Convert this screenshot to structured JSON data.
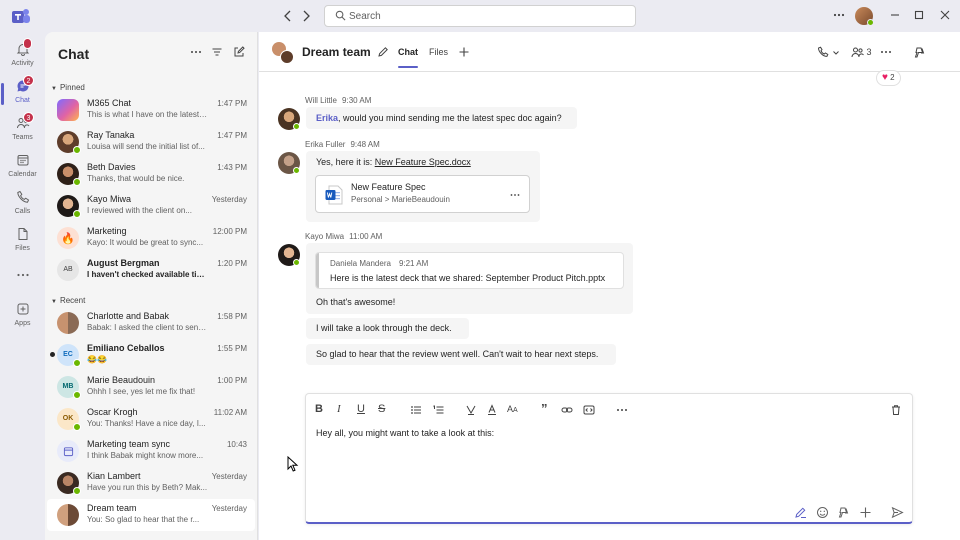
{
  "app": {
    "brand_color": "#5b5fc7",
    "window_title": ""
  },
  "titlebar": {
    "search_placeholder": "Search",
    "icons": [
      "teams-logo-icon",
      "back-icon",
      "forward-icon",
      "search-icon",
      "more-icon",
      "minimize-icon",
      "maximize-icon",
      "close-icon"
    ]
  },
  "rail": {
    "items": [
      {
        "label": "Activity",
        "badge": ""
      },
      {
        "label": "Chat",
        "badge": "2"
      },
      {
        "label": "Teams",
        "badge": "3"
      },
      {
        "label": "Calendar",
        "badge": ""
      },
      {
        "label": "Calls",
        "badge": ""
      },
      {
        "label": "Files",
        "badge": ""
      },
      {
        "label": "",
        "badge": ""
      },
      {
        "label": "Apps",
        "badge": ""
      }
    ]
  },
  "chatlist": {
    "title": "Chat",
    "pinned_label": "Pinned",
    "recent_label": "Recent",
    "pinned": [
      {
        "name": "M365 Chat",
        "time": "1:47 PM",
        "preview": "This is what I have on the latest o..."
      },
      {
        "name": "Ray Tanaka",
        "time": "1:47 PM",
        "preview": "Louisa will send the initial list of..."
      },
      {
        "name": "Beth Davies",
        "time": "1:43 PM",
        "preview": "Thanks, that would be nice."
      },
      {
        "name": "Kayo Miwa",
        "time": "Yesterday",
        "preview": "I reviewed with the client on..."
      },
      {
        "name": "Marketing",
        "time": "12:00 PM",
        "preview": "Kayo: It would be great to sync..."
      },
      {
        "name": "August Bergman",
        "time": "1:20 PM",
        "preview": "I haven't checked available time...",
        "initials": "AB"
      }
    ],
    "recent": [
      {
        "name": "Charlotte and Babak",
        "time": "1:58 PM",
        "preview": "Babak: I asked the client to send..."
      },
      {
        "name": "Emiliano Ceballos",
        "time": "1:55 PM",
        "preview": "😂😂",
        "initials": "EC"
      },
      {
        "name": "Marie Beaudouin",
        "time": "1:00 PM",
        "preview": "Ohhh I see, yes let me fix that!",
        "initials": "MB"
      },
      {
        "name": "Oscar Krogh",
        "time": "11:02 AM",
        "preview": "You: Thanks! Have a nice day, I...",
        "initials": "OK"
      },
      {
        "name": "Marketing team sync",
        "time": "10:43",
        "preview": "I think Babak might know more..."
      },
      {
        "name": "Kian Lambert",
        "time": "Yesterday",
        "preview": "Have you run this by Beth? Mak..."
      },
      {
        "name": "Dream team",
        "time": "Yesterday",
        "preview": "You: So glad to hear that the r..."
      }
    ]
  },
  "conversation": {
    "title": "Dream team",
    "tabs": [
      "Chat",
      "Files"
    ],
    "participants_count": "3",
    "reaction_count": "2",
    "messages": [
      {
        "author": "Will Little",
        "time": "9:30 AM",
        "mention": "Erika",
        "text": ", would you mind sending me the latest spec doc again?"
      },
      {
        "author": "Erika Fuller",
        "time": "9:48 AM",
        "text": "Yes, here it is: ",
        "link": "New Feature Spec.docx",
        "file": {
          "name": "New Feature Spec",
          "path": "Personal > MarieBeaudouin"
        }
      },
      {
        "author": "Kayo Miwa",
        "time": "11:00 AM",
        "quote": {
          "author": "Daniela Mandera",
          "time": "9:21 AM",
          "text": "Here is the latest deck that we shared: September Product Pitch.pptx"
        },
        "replies": [
          "Oh that's awesome!",
          "I will take a look through the deck.",
          "So glad to hear that the review went well. Can't wait to hear next steps."
        ]
      }
    ]
  },
  "composer": {
    "text": "Hey all, you might want to take a look at this:"
  }
}
